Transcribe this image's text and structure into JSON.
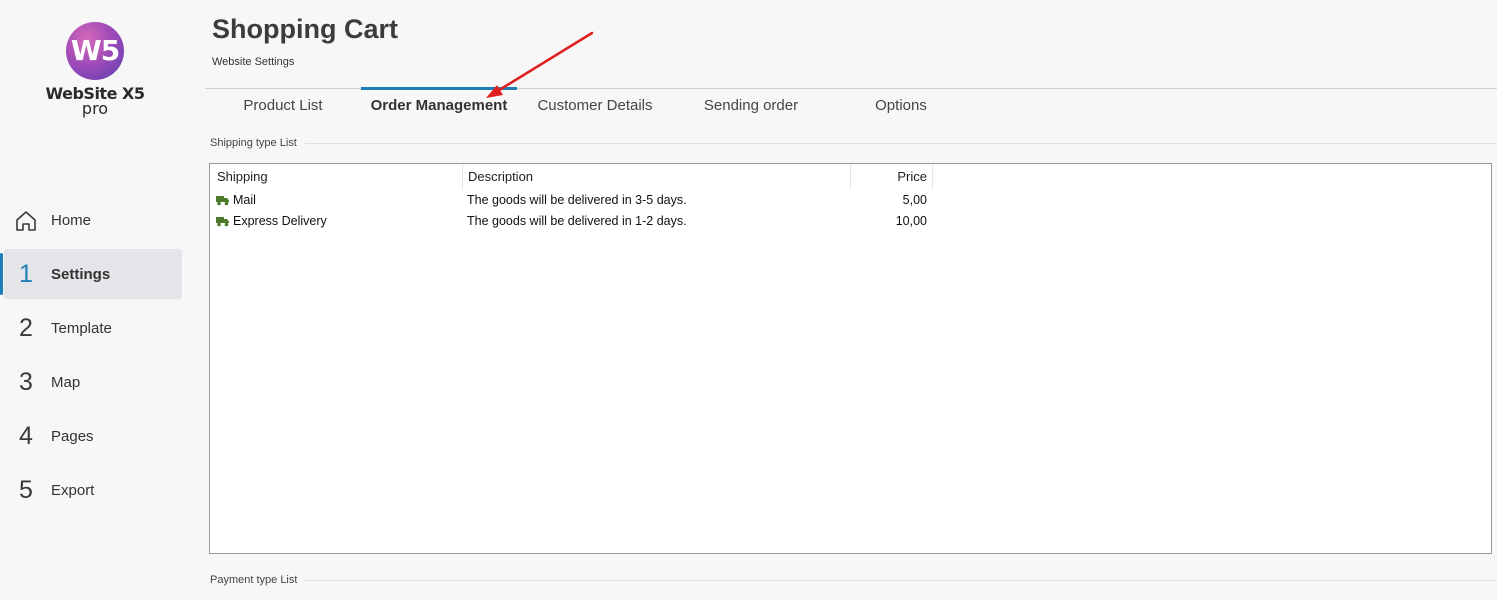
{
  "app": {
    "logo_mark": "W5",
    "logo_name": "WebSite X5",
    "logo_edition": "pro"
  },
  "sidebar": {
    "items": [
      {
        "icon": "home-icon",
        "glyph": "⌂",
        "label": "Home",
        "active": false
      },
      {
        "icon": "step-1-icon",
        "glyph": "1",
        "label": "Settings",
        "active": true
      },
      {
        "icon": "step-2-icon",
        "glyph": "2",
        "label": "Template",
        "active": false
      },
      {
        "icon": "step-3-icon",
        "glyph": "3",
        "label": "Map",
        "active": false
      },
      {
        "icon": "step-4-icon",
        "glyph": "4",
        "label": "Pages",
        "active": false
      },
      {
        "icon": "step-5-icon",
        "glyph": "5",
        "label": "Export",
        "active": false
      }
    ]
  },
  "header": {
    "title": "Shopping Cart",
    "subtitle": "Website Settings"
  },
  "tabs": [
    {
      "label": "Product List",
      "active": false
    },
    {
      "label": "Order Management",
      "active": true
    },
    {
      "label": "Customer Details",
      "active": false
    },
    {
      "label": "Sending order",
      "active": false
    },
    {
      "label": "Options",
      "active": false
    }
  ],
  "shipping": {
    "section_label": "Shipping type List",
    "columns": {
      "shipping": "Shipping",
      "description": "Description",
      "price": "Price"
    },
    "rows": [
      {
        "icon": "truck-icon",
        "name": "Mail",
        "description": "The goods will be delivered in 3-5 days.",
        "price": "5,00"
      },
      {
        "icon": "truck-icon",
        "name": "Express Delivery",
        "description": "The goods will be delivered in 1-2 days.",
        "price": "10,00"
      }
    ]
  },
  "payment": {
    "section_label": "Payment type List"
  },
  "colors": {
    "accent": "#1d7eb5",
    "annotation_arrow": "#e02020",
    "truck_icon": "#4a7a2a"
  }
}
